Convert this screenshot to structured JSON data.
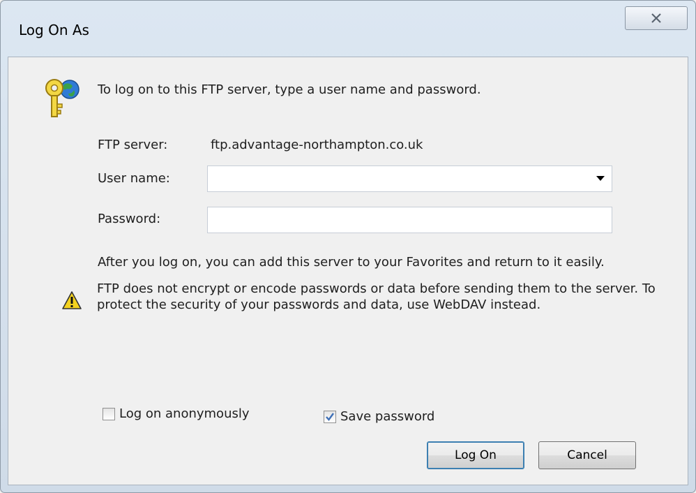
{
  "window": {
    "title": "Log On As"
  },
  "icons": {
    "close": "close-icon",
    "keys": "key-globe-icon",
    "warning": "warning-icon",
    "dropdown": "chevron-down-icon"
  },
  "intro_text": "To log on to this FTP server, type a user name and password.",
  "form": {
    "server_label": "FTP server:",
    "server_value": "ftp.advantage-northampton.co.uk",
    "username_label": "User name:",
    "username_value": "",
    "password_label": "Password:",
    "password_value": ""
  },
  "info_text": "After you log on, you can add this server to your Favorites and return to it easily.",
  "warning_text": "FTP does not encrypt or encode passwords or data before sending them to the server.  To protect the security of your passwords and data, use WebDAV instead.",
  "options": {
    "anonymous_label": "Log on anonymously",
    "anonymous_checked": false,
    "save_password_label": "Save password",
    "save_password_checked": true
  },
  "buttons": {
    "logon_label": "Log On",
    "cancel_label": "Cancel"
  },
  "colors": {
    "frame": "#dce7f2",
    "client": "#f0f0f0",
    "check": "#3d6fb6"
  }
}
